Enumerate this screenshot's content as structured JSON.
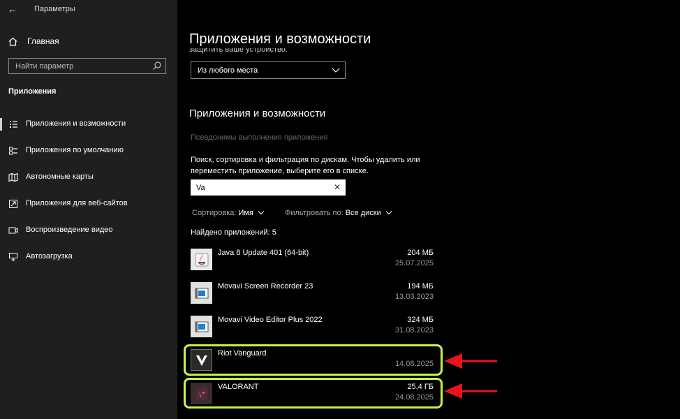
{
  "window": {
    "title": "Параметры",
    "back_glyph": "←"
  },
  "sidebar": {
    "home_label": "Главная",
    "search_placeholder": "Найти параметр",
    "section_title": "Приложения",
    "items": [
      {
        "label": "Приложения и возможности",
        "icon": "apps-features-icon",
        "active": true
      },
      {
        "label": "Приложения по умолчанию",
        "icon": "default-apps-icon",
        "active": false
      },
      {
        "label": "Автономные карты",
        "icon": "offline-maps-icon",
        "active": false
      },
      {
        "label": "Приложения для веб-сайтов",
        "icon": "apps-for-websites-icon",
        "active": false
      },
      {
        "label": "Воспроизведение видео",
        "icon": "video-playback-icon",
        "active": false
      },
      {
        "label": "Автозагрузка",
        "icon": "startup-icon",
        "active": false
      }
    ]
  },
  "main": {
    "page_title": "Приложения и возможности",
    "cut_text": "защитить ваше устройство.",
    "source_dropdown": "Из любого места",
    "section_title": "Приложения и возможности",
    "alias_link": "Псевдонимы выполнения приложения",
    "description": "Поиск, сортировка и фильтрация по дискам. Чтобы удалить или переместить приложение, выберите его в списке.",
    "filter_value": "Va",
    "sort_label": "Сортировка:",
    "sort_value": "Имя",
    "filter_label": "Фильтровать по:",
    "filter_drive": "Все диски",
    "found_text": "Найдено приложений: 5",
    "apps": [
      {
        "name": "Java 8 Update 401 (64-bit)",
        "size": "204 МБ",
        "date": "25.07.2025",
        "icon": "java-icon"
      },
      {
        "name": "Movavi Screen Recorder 23",
        "size": "194 МБ",
        "date": "13.03.2023",
        "icon": "movavi-recorder-icon"
      },
      {
        "name": "Movavi Video Editor Plus 2022",
        "size": "324 МБ",
        "date": "31.08.2023",
        "icon": "movavi-editor-icon"
      },
      {
        "name": "Riot Vanguard",
        "size": "",
        "date": "14.08.2025",
        "icon": "riot-vanguard-icon"
      },
      {
        "name": "VALORANT",
        "size": "25,4 ГБ",
        "date": "24.08.2025",
        "icon": "valorant-icon"
      }
    ]
  },
  "colors": {
    "highlight": "#c6f24a",
    "arrow": "#e8141c",
    "sidebar_bg": "#1f1f1f"
  }
}
